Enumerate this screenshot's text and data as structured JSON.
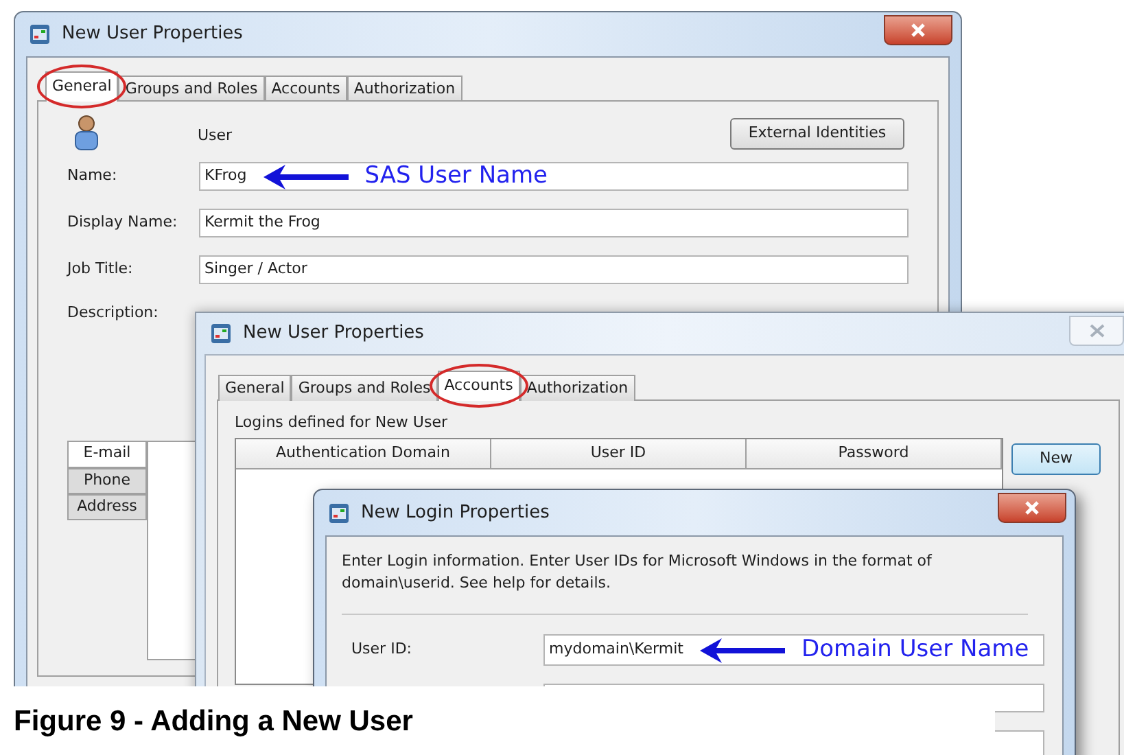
{
  "user_window": {
    "title": "New User Properties",
    "tabs": [
      {
        "label": "General",
        "selected": true
      },
      {
        "label": "Groups and Roles",
        "selected": false
      },
      {
        "label": "Accounts",
        "selected": false
      },
      {
        "label": "Authorization",
        "selected": false
      }
    ],
    "type_label": "User",
    "external_button": "External Identities",
    "fields": [
      {
        "label": "Name:",
        "value": "KFrog",
        "annotation": "SAS User Name"
      },
      {
        "label": "Display Name:",
        "value": "Kermit the Frog"
      },
      {
        "label": "Job Title:",
        "value": "Singer / Actor"
      }
    ],
    "description_label": "Description:",
    "contact_tabs": [
      {
        "label": "E-mail",
        "selected": true
      },
      {
        "label": "Phone",
        "selected": false
      },
      {
        "label": "Address",
        "selected": false
      }
    ]
  },
  "accounts_window": {
    "title": "New User Properties",
    "tabs": [
      {
        "label": "General",
        "selected": false
      },
      {
        "label": "Groups and Roles",
        "selected": false
      },
      {
        "label": "Accounts",
        "selected": true
      },
      {
        "label": "Authorization",
        "selected": false
      }
    ],
    "group_label": "Logins defined for New User",
    "columns": [
      "Authentication Domain",
      "User ID",
      "Password"
    ],
    "new_button": "New"
  },
  "login_window": {
    "title": "New Login Properties",
    "instructions": "Enter Login information. Enter User IDs for Microsoft Windows in the format of domain\\userid. See help for details.",
    "fields": [
      {
        "label": "User ID:",
        "value": "mydomain\\Kermit",
        "annotation": "Domain User Name"
      }
    ]
  },
  "caption": "Figure 9 - Adding a New User"
}
